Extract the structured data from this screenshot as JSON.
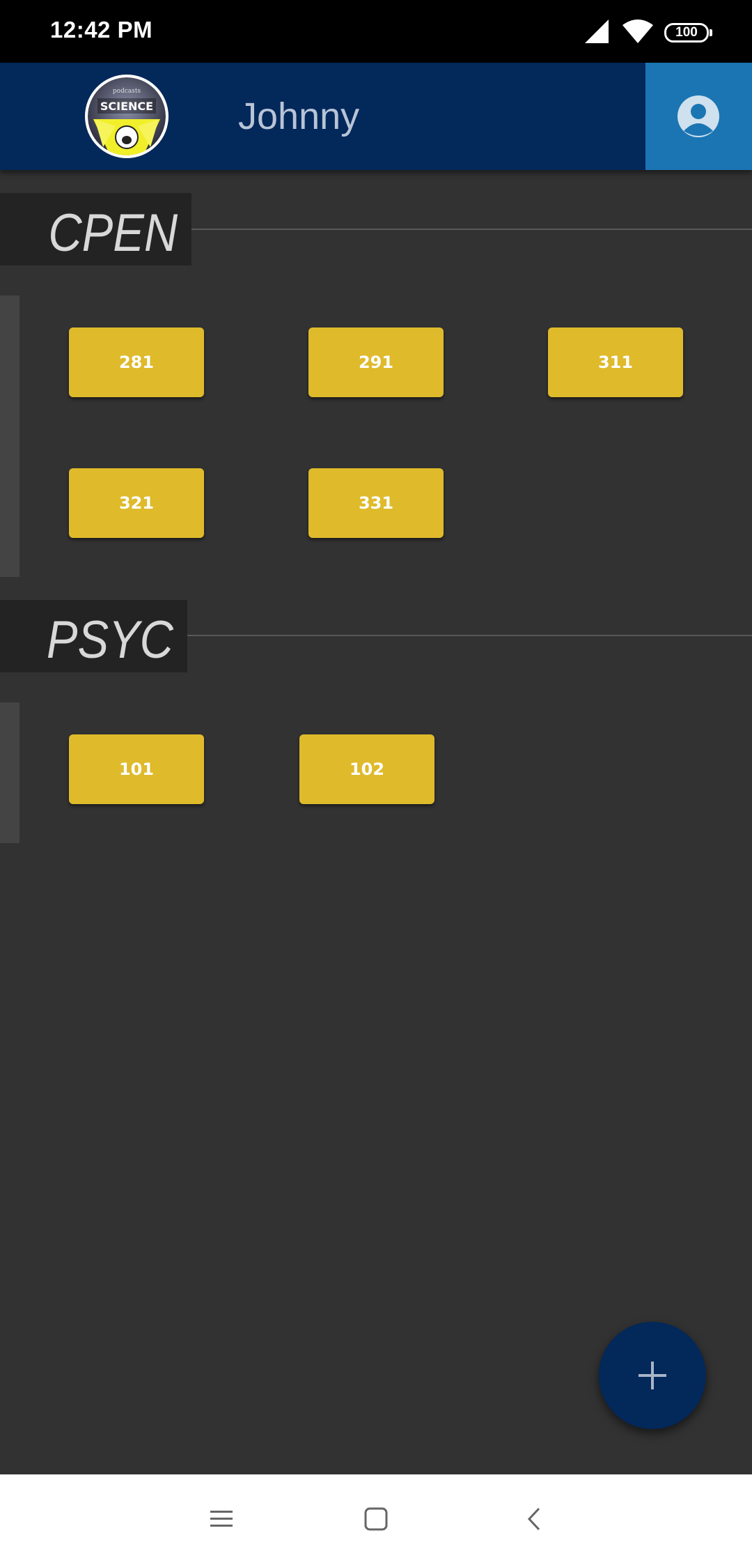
{
  "status_bar": {
    "time": "12:42 PM",
    "battery": "100"
  },
  "header": {
    "logo_text": "SCIENCE",
    "logo_small_text": "podcasts",
    "username": "Johnny"
  },
  "sections": [
    {
      "title": "CPEN",
      "courses": [
        "281",
        "291",
        "311",
        "321",
        "331"
      ]
    },
    {
      "title": "PSYC",
      "courses": [
        "101",
        "102"
      ]
    }
  ],
  "fab": {
    "icon": "plus-icon"
  },
  "nav": {
    "icons": [
      "menu-icon",
      "home-square-icon",
      "back-chevron-icon"
    ]
  },
  "colors": {
    "background": "#323232",
    "header": "#03285a",
    "profile_button": "#1b75b3",
    "course_button": "#dfba2b",
    "section_title_bg": "#232323"
  }
}
